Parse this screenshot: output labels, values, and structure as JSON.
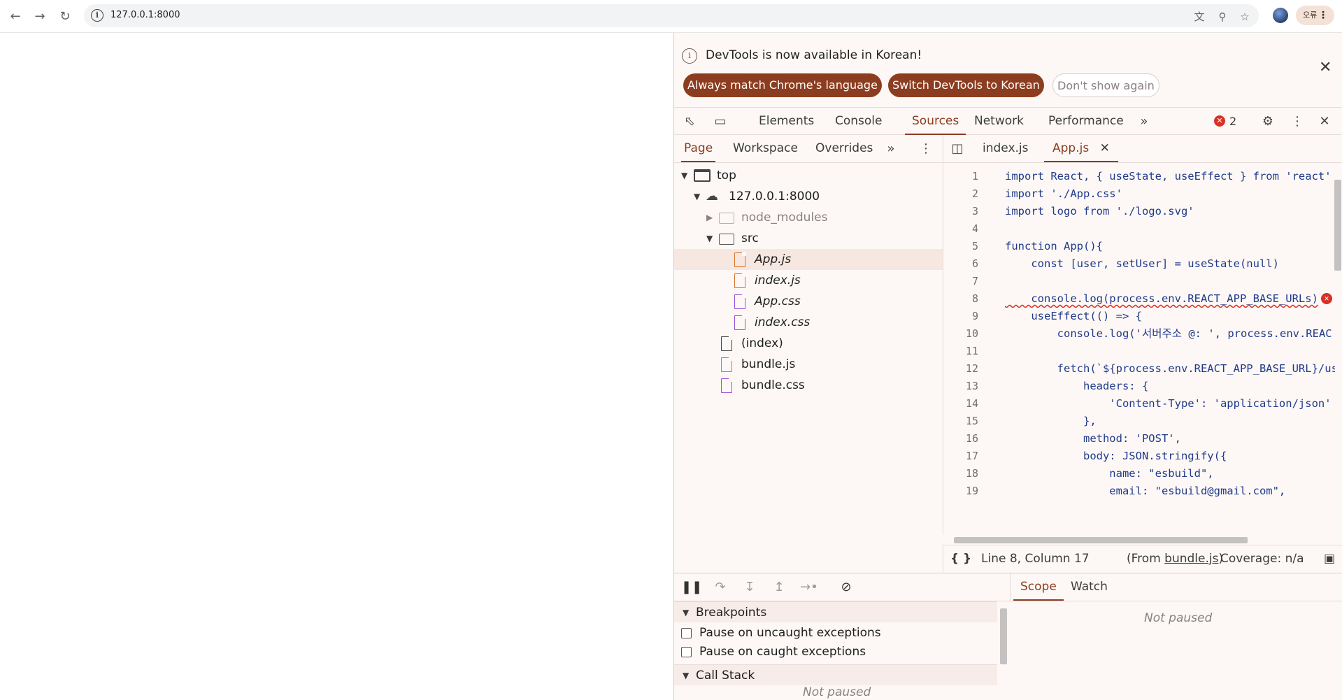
{
  "browser": {
    "url": "127.0.0.1:8000",
    "profile_menu_label": "오류",
    "icons": [
      "back-arrow-icon",
      "forward-arrow-icon",
      "reload-icon",
      "site-info-icon",
      "translate-icon",
      "zoom-icon",
      "bookmark-star-icon",
      "kebab-menu-icon"
    ]
  },
  "infobar": {
    "message": "DevTools is now available in Korean!",
    "always_match": "Always match Chrome's language",
    "switch_korean": "Switch DevTools to Korean",
    "dont_show": "Don't show again"
  },
  "main_tabs": [
    "Elements",
    "Console",
    "Sources",
    "Network",
    "Performance"
  ],
  "active_main_tab": "Sources",
  "error_count": "2",
  "navigator": {
    "tabs": [
      "Page",
      "Workspace",
      "Overrides"
    ],
    "tree": [
      {
        "label": "top"
      },
      {
        "label": "127.0.0.1:8000"
      },
      {
        "label": "node_modules"
      },
      {
        "label": "src"
      },
      {
        "label": "App.js"
      },
      {
        "label": "index.js"
      },
      {
        "label": "App.css"
      },
      {
        "label": "index.css"
      },
      {
        "label": "(index)"
      },
      {
        "label": "bundle.js"
      },
      {
        "label": "bundle.css"
      }
    ]
  },
  "editor": {
    "tabs": [
      "index.js",
      "App.js"
    ],
    "active_tab": "App.js",
    "lines": [
      {
        "n": "1",
        "text": "import React, { useState, useEffect } from 'react'"
      },
      {
        "n": "2",
        "text": "import './App.css'"
      },
      {
        "n": "3",
        "text": "import logo from './logo.svg'"
      },
      {
        "n": "4",
        "text": ""
      },
      {
        "n": "5",
        "text": "function App(){"
      },
      {
        "n": "6",
        "text": "    const [user, setUser] = useState(null)"
      },
      {
        "n": "7",
        "text": ""
      },
      {
        "n": "8",
        "text": "    console.log(process.env.REACT_APP_BASE_URLs)"
      },
      {
        "n": "9",
        "text": "    useEffect(() => {"
      },
      {
        "n": "10",
        "text": "        console.log('서버주소 @: ', process.env.REAC"
      },
      {
        "n": "11",
        "text": ""
      },
      {
        "n": "12",
        "text": "        fetch(`${process.env.REACT_APP_BASE_URL}/use"
      },
      {
        "n": "13",
        "text": "            headers: {"
      },
      {
        "n": "14",
        "text": "                'Content-Type': 'application/json'"
      },
      {
        "n": "15",
        "text": "            },"
      },
      {
        "n": "16",
        "text": "            method: 'POST',"
      },
      {
        "n": "17",
        "text": "            body: JSON.stringify({"
      },
      {
        "n": "18",
        "text": "                name: \"esbuild\","
      },
      {
        "n": "19",
        "text": "                email: \"esbuild@gmail.com\","
      }
    ]
  },
  "status": {
    "position": "Line 8, Column 17",
    "from_prefix": "(From ",
    "from_file": "bundle.js",
    "from_suffix": ")",
    "coverage": "Coverage: n/a"
  },
  "debugger": {
    "breakpoints_label": "Breakpoints",
    "pause_uncaught": "Pause on uncaught exceptions",
    "pause_caught": "Pause on caught exceptions",
    "call_stack_label": "Call Stack",
    "not_paused": "Not paused",
    "scope_tabs": [
      "Scope",
      "Watch"
    ],
    "scope_not_paused": "Not paused"
  }
}
